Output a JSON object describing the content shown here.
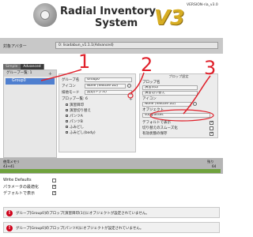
{
  "header": {
    "title_line1": "Radial Inventory",
    "title_line2": "System",
    "version_badge": "V3",
    "version_text": "VERSION-ria_v3.0"
  },
  "avatar": {
    "label": "対象アバター",
    "value": "0: lisadabun_v1.1.1(Advanced)"
  },
  "tabs": [
    {
      "label": "Simple",
      "active": false
    },
    {
      "label": "Advanced",
      "active": true
    }
  ],
  "group_list": {
    "header": "グループ一覧: 1",
    "items": [
      "Group0"
    ]
  },
  "group_props": {
    "rows": [
      {
        "label": "グループ名",
        "value": "Group0"
      },
      {
        "label": "アイコン",
        "value": "None (Texture 2D)"
      },
      {
        "label": "排他モード",
        "value": "無効(トグル)"
      },
      {
        "label": "プロップ一覧: 6",
        "value": ""
      }
    ],
    "prop_items": [
      "演習目印",
      "演習切り替え",
      "パンツA",
      "パンツB",
      "ふみどし",
      "ふみどし(body)"
    ]
  },
  "prop_details": {
    "title": "プロップ設定",
    "rows": [
      {
        "label": "プロップ名",
        "value": "演習目印"
      },
      {
        "label": "",
        "value": "演習切り替え"
      },
      {
        "label": "アイコン",
        "value": ""
      },
      {
        "label": "",
        "value": "None (Texture 2D)"
      },
      {
        "label": "オブジェクト",
        "value": ""
      },
      {
        "label": "",
        "value": "sunglasses"
      }
    ],
    "checks": [
      {
        "label": "デフォルトで表示",
        "checked": true
      },
      {
        "label": "切り替えのスムーズ化",
        "checked": false
      },
      {
        "label": "有効状態の保存",
        "checked": true
      }
    ]
  },
  "memory": {
    "left_label": "使用メモリ",
    "right_label": "残り",
    "left_value": "43+41",
    "right_value": "64",
    "used_fraction": 0.99
  },
  "settings": [
    {
      "label": "Write Defaults",
      "checked": false
    },
    {
      "label": "パラメータの最適化",
      "checked": true
    },
    {
      "label": "デフォルトで表示",
      "checked": true
    }
  ],
  "warnings": [
    "グループ[Group0]のプロップ[演習目印(1)]にオブジェクトが設定されていません。",
    "グループ[Group0]のプロップ[パンツA]にオブジェクトが設定されていません。"
  ],
  "annotations": [
    "1",
    "2",
    "3"
  ],
  "colors": {
    "accent_gold": "#d7ad22",
    "selection_blue": "#4f7fcf",
    "warning_red": "#d0021b",
    "annotation_red": "#e0202a",
    "memory_green": "#6fa23d"
  }
}
